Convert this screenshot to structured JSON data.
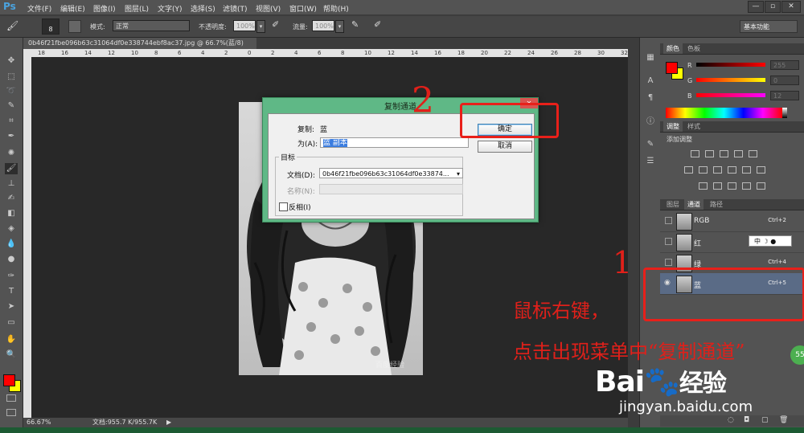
{
  "app": {
    "logo": "Ps"
  },
  "menu": [
    "文件(F)",
    "编辑(E)",
    "图像(I)",
    "图层(L)",
    "文字(Y)",
    "选择(S)",
    "滤镜(T)",
    "视图(V)",
    "窗口(W)",
    "帮助(H)"
  ],
  "window_controls": [
    "—",
    "▫",
    "✕"
  ],
  "options": {
    "brush_size": "8",
    "mode_label": "模式:",
    "mode_value": "正常",
    "opacity_label": "不透明度:",
    "opacity_value": "100%",
    "flow_label": "流量:",
    "flow_value": "100%",
    "workspace": "基本功能"
  },
  "document": {
    "tab_title": "0b46f21fbe096b63c31064df0e338744ebf8ac37.jpg @ 66.7%(蓝/8)",
    "tab_close": "×",
    "ruler_labels": [
      "18",
      "16",
      "14",
      "12",
      "10",
      "8",
      "6",
      "4",
      "2",
      "0",
      "2",
      "4",
      "6",
      "8",
      "10",
      "12",
      "14",
      "16",
      "18",
      "20",
      "22",
      "24",
      "26",
      "28",
      "30",
      "32"
    ],
    "watermark": "百度经验"
  },
  "status": {
    "zoom": "66.67%",
    "doc_size": "文档:955.7 K/955.7K"
  },
  "dialog": {
    "title": "复制通道",
    "copy_label": "复制:",
    "copy_value": "蓝",
    "as_label": "为(A):",
    "as_value": "蓝 副本",
    "target_group": "目标",
    "doc_label": "文档(D):",
    "doc_value": "0b46f21fbe096b63c31064df0e33874...",
    "name_label": "名称(N):",
    "invert_label": "反相(I)",
    "ok_label": "确定",
    "cancel_label": "取消",
    "close": "✕"
  },
  "color_panel": {
    "tabs": [
      "颜色",
      "色板"
    ],
    "channels": [
      {
        "label": "R",
        "value": "255"
      },
      {
        "label": "G",
        "value": "0"
      },
      {
        "label": "B",
        "value": "12"
      }
    ],
    "foreground": "#ff0000",
    "background": "#ffff00"
  },
  "adjust_panel": {
    "tabs": [
      "调整",
      "样式"
    ],
    "add_label": "添加调整"
  },
  "channels_panel": {
    "tabs": [
      "图层",
      "通道",
      "路径"
    ],
    "rows": [
      {
        "name": "RGB",
        "shortcut": "Ctrl+2"
      },
      {
        "name": "红",
        "shortcut": ""
      },
      {
        "name": "绿",
        "shortcut": "Ctrl+4"
      },
      {
        "name": "蓝",
        "shortcut": "Ctrl+5"
      }
    ],
    "ime": "中"
  },
  "annotations": {
    "step2": "2",
    "step1": "1",
    "line1": "鼠标右键，",
    "line2": "点击出现菜单中“复制通道”",
    "badge": "55"
  },
  "branding": {
    "logo_a": "Bai",
    "logo_b": "经验",
    "url": "jingyan.baidu.com"
  }
}
